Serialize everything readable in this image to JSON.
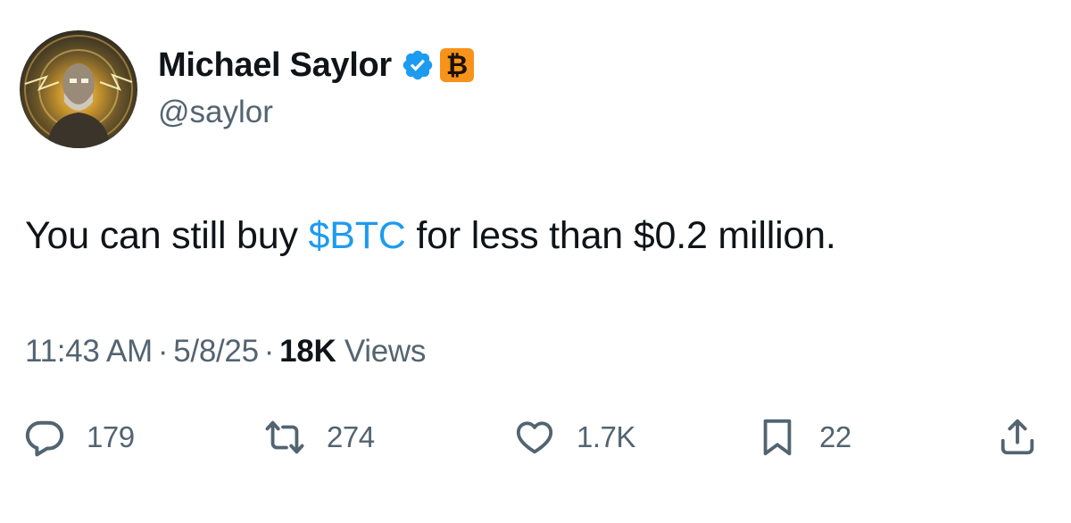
{
  "author": {
    "name": "Michael Saylor",
    "handle": "@saylor",
    "verified_icon": "verified-badge-icon",
    "badge_icon": "bitcoin-icon",
    "badge_symbol": "₿",
    "badge_color": "#f7931a"
  },
  "tweet": {
    "text_before": "You can still buy ",
    "cashtag": "$BTC",
    "text_after": " for less than $0.2 million."
  },
  "meta": {
    "time": "11:43 AM",
    "separator": "·",
    "date": "5/8/25",
    "views_count": "18K",
    "views_label": "Views"
  },
  "actions": {
    "replies": {
      "icon": "reply-icon",
      "count": "179"
    },
    "reposts": {
      "icon": "repost-icon",
      "count": "274"
    },
    "likes": {
      "icon": "heart-icon",
      "count": "1.7K"
    },
    "bookmarks": {
      "icon": "bookmark-icon",
      "count": "22"
    },
    "share": {
      "icon": "share-icon"
    }
  },
  "colors": {
    "text": "#0f1419",
    "secondary": "#536471",
    "link": "#1d9bf0",
    "verified": "#1d9bf0"
  }
}
